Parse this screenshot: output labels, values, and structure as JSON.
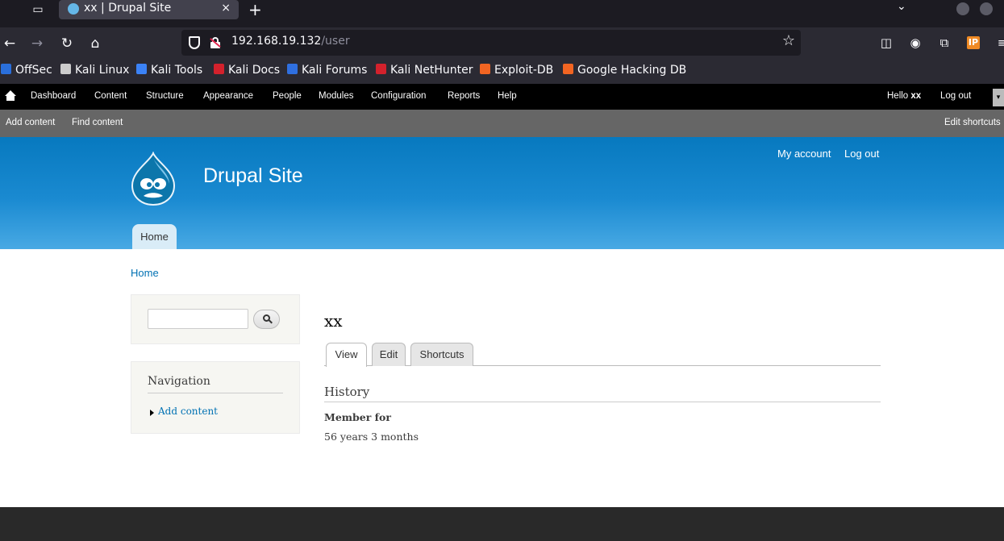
{
  "browser": {
    "tab": {
      "title": "xx | Drupal Site",
      "close": "×"
    },
    "new_tab": "+",
    "url": {
      "host": "192.168.19.132",
      "path": "/user"
    },
    "bookmarks": [
      {
        "label": "OffSec",
        "color": "#2a6fdb"
      },
      {
        "label": "Kali Linux",
        "color": "#cccccc"
      },
      {
        "label": "Kali Tools",
        "color": "#3b82f6"
      },
      {
        "label": "Kali Docs",
        "color": "#d3212c"
      },
      {
        "label": "Kali Forums",
        "color": "#2f6fe0"
      },
      {
        "label": "Kali NetHunter",
        "color": "#d3212c"
      },
      {
        "label": "Exploit-DB",
        "color": "#f26522"
      },
      {
        "label": "Google Hacking DB",
        "color": "#f26522"
      }
    ],
    "ip_badge": "IP"
  },
  "toolbar": {
    "menu": [
      "Dashboard",
      "Content",
      "Structure",
      "Appearance",
      "People",
      "Modules",
      "Configuration",
      "Reports",
      "Help"
    ],
    "hello_prefix": "Hello ",
    "username": "xx",
    "logout": "Log out",
    "shortcuts": [
      "Add content",
      "Find content"
    ],
    "edit_shortcuts": "Edit shortcuts"
  },
  "header": {
    "site_name": "Drupal Site",
    "secondary": [
      "My account",
      "Log out"
    ],
    "main_menu": [
      "Home"
    ]
  },
  "breadcrumb": "Home",
  "sidebar": {
    "navigation_title": "Navigation",
    "navigation_items": [
      "Add content"
    ]
  },
  "content": {
    "title": "xx",
    "tabs": [
      "View",
      "Edit",
      "Shortcuts"
    ],
    "history_title": "History",
    "member_for_label": "Member for",
    "member_for_value": "56 years 3 months"
  }
}
